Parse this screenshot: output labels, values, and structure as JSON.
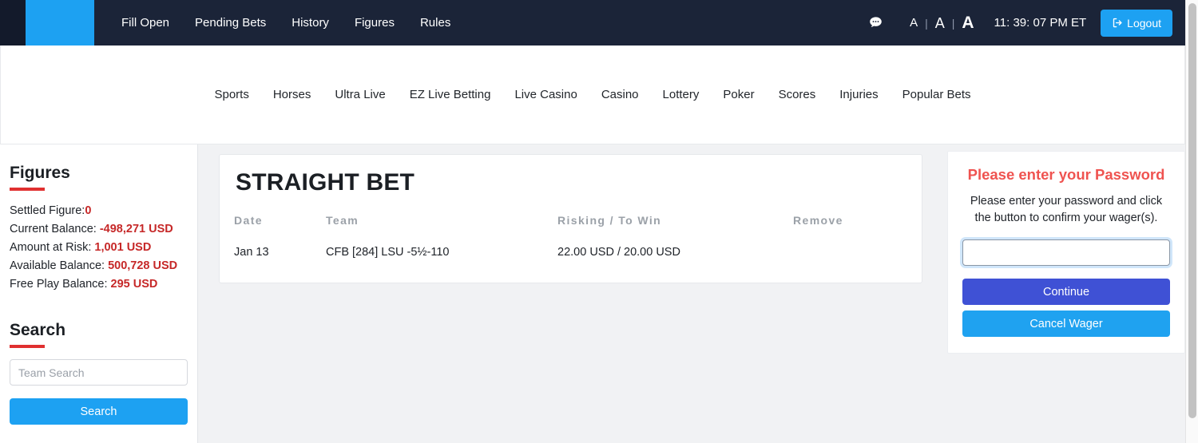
{
  "topbar": {
    "brand_color": "#1da1f2",
    "background_color": "#1b2438",
    "nav_items": [
      {
        "label": "Fill Open"
      },
      {
        "label": "Pending Bets"
      },
      {
        "label": "History"
      },
      {
        "label": "Figures"
      },
      {
        "label": "Rules"
      }
    ],
    "chat_icon": "chat-bubble-icon",
    "font_sizes": [
      {
        "label": "A",
        "size": "small"
      },
      {
        "label": "A",
        "size": "medium"
      },
      {
        "label": "A",
        "size": "large"
      }
    ],
    "separator": "|",
    "clock": "11: 39: 07 PM ET",
    "logout_label": "Logout",
    "logout_icon": "sign-out-icon"
  },
  "subnav": {
    "items": [
      {
        "label": "Sports"
      },
      {
        "label": "Horses"
      },
      {
        "label": "Ultra Live"
      },
      {
        "label": "EZ Live Betting"
      },
      {
        "label": "Live Casino"
      },
      {
        "label": "Casino"
      },
      {
        "label": "Lottery"
      },
      {
        "label": "Poker"
      },
      {
        "label": "Scores"
      },
      {
        "label": "Injuries"
      },
      {
        "label": "Popular Bets"
      }
    ]
  },
  "sidebar": {
    "figures": {
      "heading": "Figures",
      "rule_color": "#e03030",
      "rows": [
        {
          "label": "Settled Figure:",
          "value": "0"
        },
        {
          "label": "Current Balance: ",
          "value": "-498,271 USD"
        },
        {
          "label": "Amount at Risk: ",
          "value": "1,001 USD"
        },
        {
          "label": "Available Balance: ",
          "value": "500,728 USD"
        },
        {
          "label": "Free Play Balance: ",
          "value": "295 USD"
        }
      ],
      "value_color": "#c62828"
    },
    "search": {
      "heading": "Search",
      "input_placeholder": "Team Search",
      "input_value": "",
      "button_label": "Search",
      "button_color": "#1da1f2"
    }
  },
  "bet_card": {
    "title": "STRAIGHT BET",
    "columns": [
      "Date",
      "Team",
      "Risking / To Win",
      "Remove"
    ],
    "rows": [
      {
        "date": "Jan 13",
        "team": "CFB [284] LSU -5½-110",
        "risking": "22.00 USD / 20.00 USD",
        "remove": ""
      }
    ]
  },
  "password_panel": {
    "title": "Please enter your Password",
    "title_color": "#ef5350",
    "description": "Please enter your password and click the button to confirm your wager(s).",
    "input_value": "",
    "input_placeholder": "",
    "continue_label": "Continue",
    "continue_color": "#3f51d5",
    "cancel_label": "Cancel Wager",
    "cancel_color": "#1fa2f0"
  }
}
